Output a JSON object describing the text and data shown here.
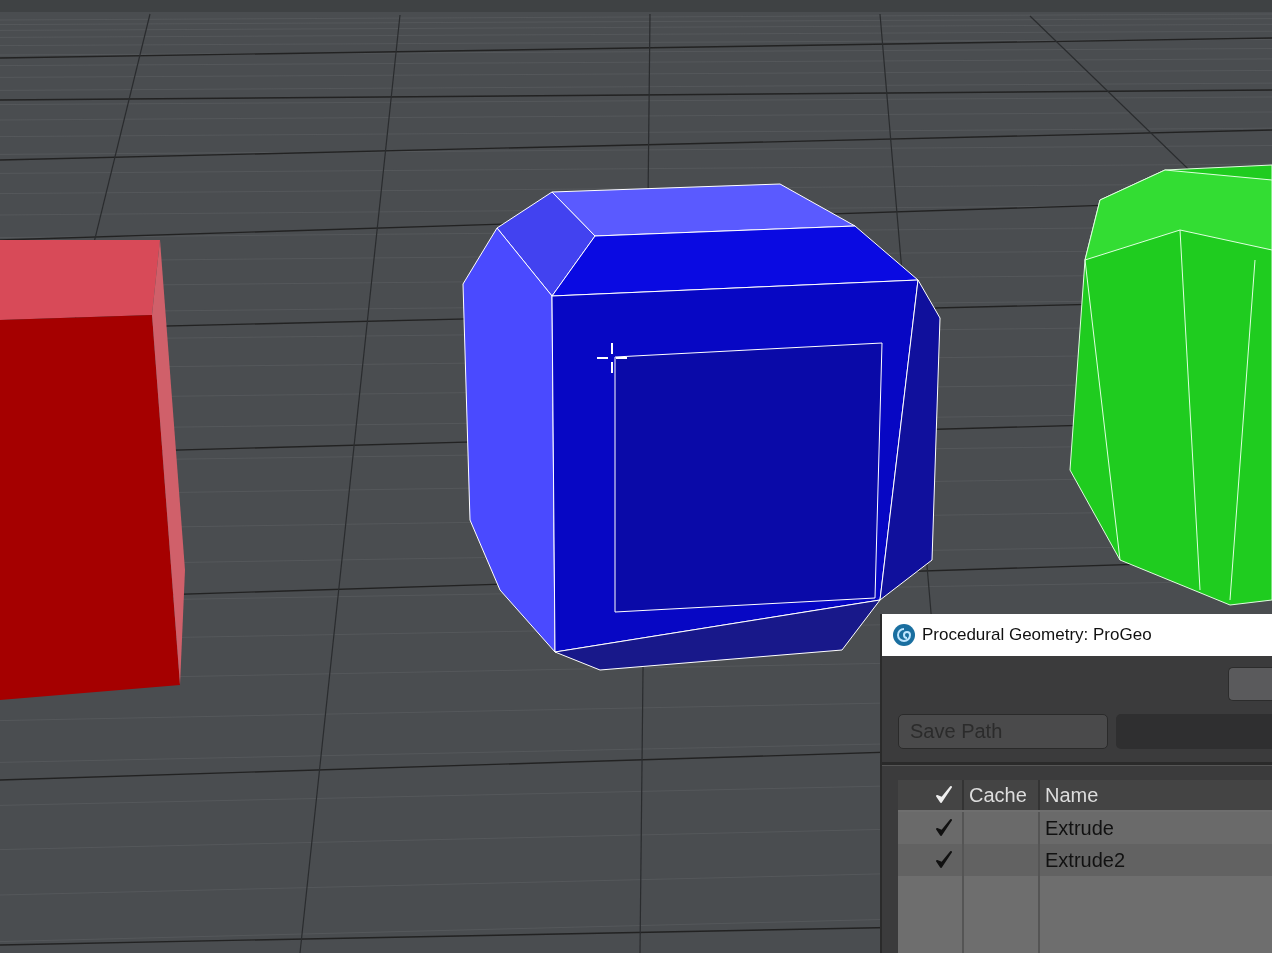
{
  "dialog": {
    "title": "Procedural Geometry: ProGeo",
    "save_path": {
      "label": "Save Path",
      "disabled": true
    },
    "table": {
      "columns": [
        "Cache",
        "Name"
      ],
      "rows": [
        {
          "enabled": true,
          "name": "Extrude"
        },
        {
          "enabled": true,
          "name": "Extrude2"
        }
      ]
    }
  }
}
